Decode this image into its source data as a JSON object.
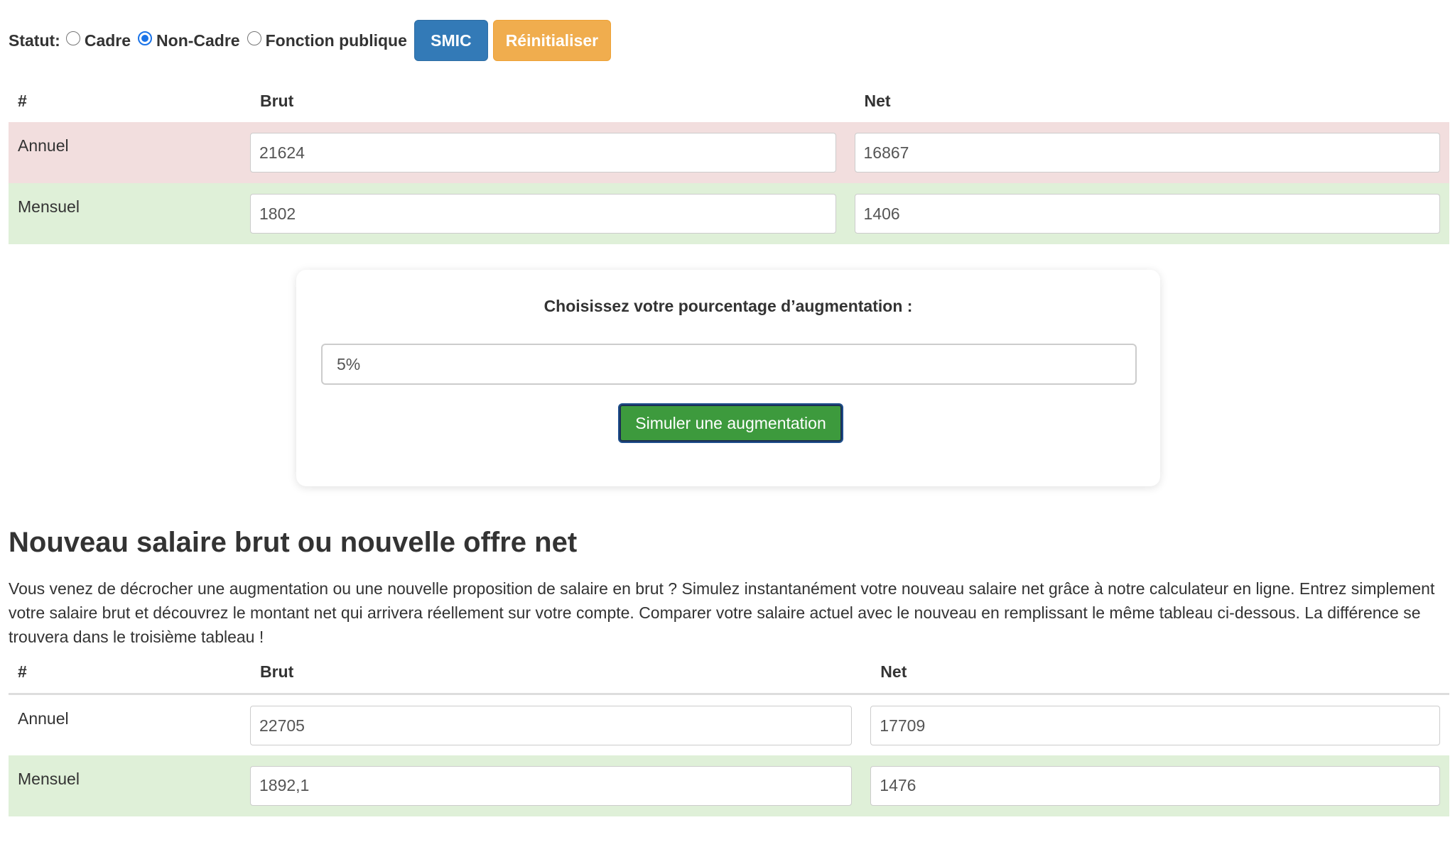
{
  "status": {
    "label": "Statut:",
    "options": [
      {
        "label": "Cadre",
        "checked": false
      },
      {
        "label": "Non-Cadre",
        "checked": true
      },
      {
        "label": "Fonction publique",
        "checked": false
      }
    ],
    "smic_label": "SMIC",
    "reset_label": "Réinitialiser"
  },
  "table1": {
    "headers": [
      "#",
      "Brut",
      "Net"
    ],
    "rows": [
      {
        "label": "Annuel",
        "brut": "21624",
        "net": "16867"
      },
      {
        "label": "Mensuel",
        "brut": "1802",
        "net": "1406"
      }
    ]
  },
  "augmentation": {
    "title": "Choisissez votre pourcentage d’augmentation :",
    "value": "5%",
    "button_label": "Simuler une augmentation"
  },
  "section": {
    "title": "Nouveau salaire brut ou nouvelle offre net",
    "description": "Vous venez de décrocher une augmentation ou une nouvelle proposition de salaire en brut ? Simulez instantanément votre nouveau salaire net grâce à notre calculateur en ligne. Entrez simplement votre salaire brut et découvrez le montant net qui arrivera réellement sur votre compte. Comparer votre salaire actuel avec le nouveau en remplissant le même tableau ci-dessous. La différence se trouvera dans le troisième tableau !"
  },
  "table2": {
    "headers": [
      "#",
      "Brut",
      "Net"
    ],
    "rows": [
      {
        "label": "Annuel",
        "brut": "22705",
        "net": "17709"
      },
      {
        "label": "Mensuel",
        "brut": "1892,1",
        "net": "1476"
      }
    ]
  },
  "colors": {
    "smic": "#337ab7",
    "reset": "#f0ad4e",
    "simulate": "#3d9a3d",
    "row_danger": "#f2dede",
    "row_success": "#dff0d8"
  }
}
